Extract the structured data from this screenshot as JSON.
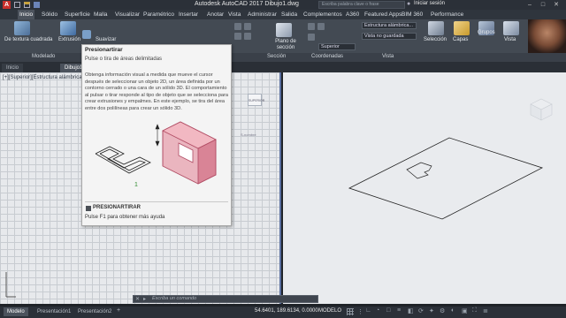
{
  "titlebar": {
    "title": "Autodesk AutoCAD 2017   Dibujo1.dwg",
    "search_placeholder": "Escriba palabra clave o frase",
    "login": "Iniciar sesión"
  },
  "ribbon_tabs": [
    {
      "label": "Inicio",
      "active": true
    },
    {
      "label": "Sólido"
    },
    {
      "label": "Superficie"
    },
    {
      "label": "Malla"
    },
    {
      "label": "Visualizar"
    },
    {
      "label": "Paramétrico"
    },
    {
      "label": "Insertar"
    },
    {
      "label": "Anotar"
    },
    {
      "label": "Vista"
    },
    {
      "label": "Administrar"
    },
    {
      "label": "Salida"
    },
    {
      "label": "Complementos"
    },
    {
      "label": "A360"
    },
    {
      "label": "Featured Apps"
    },
    {
      "label": "BIM 360"
    },
    {
      "label": "Performance"
    }
  ],
  "ribbon": {
    "btn_textura": "De textura cuadrada",
    "btn_extrusion": "Extrusión",
    "btn_suavizar": "Suavizar",
    "btn_plano": "Plano de sección",
    "btn_seleccion": "Selección",
    "btn_capas": "Capas",
    "btn_grupos": "Grupos",
    "btn_vista": "Vista",
    "combo_style": "Estructura alámbrica...",
    "combo_view": "Vista no guardada",
    "combo_view2": "Superior",
    "panel_modelado": "Modelado",
    "panel_seccion": "Sección",
    "panel_coordenadas": "Coordenadas",
    "panel_vista": "Vista"
  },
  "file_tabs": [
    {
      "label": "Inicio"
    },
    {
      "label": "Dibujo1*",
      "active": true
    }
  ],
  "viewport": {
    "label": "[+][Superior][Estructura alámbrica 2D]",
    "viewcube_label": "SUPERIOR",
    "wcs_label": "S-nombre"
  },
  "tooltip": {
    "title": "Presionartirar",
    "subtitle": "Pulse o tira de áreas delimitadas",
    "body": "Obtenga información visual a medida que mueve el cursor después de seleccionar un objeto 2D, un área definida por un contorno cerrado o una cara de un sólido 3D. El comportamiento al pulsar o tirar responde al tipo de objeto que se selecciona para crear extrusiones y empalmes. En este ejemplo, se tira del área entre dos polilíneas para crear un sólido 3D.",
    "marker": "1",
    "command": "PRESIONARTIRAR",
    "help": "Pulse F1 para obtener más ayuda"
  },
  "command_line": {
    "placeholder": "Escriba un comando"
  },
  "status": {
    "tabs": [
      {
        "label": "Modelo",
        "active": true
      },
      {
        "label": "Presentación1"
      },
      {
        "label": "Presentación2"
      }
    ],
    "coords": "54.6401, 189.6134, 0.0000",
    "mode": "MODELO"
  },
  "colors": {
    "accent": "#5a6fa0",
    "extrude_fill": "#e69aa8",
    "extrude_stroke": "#b04a62"
  }
}
